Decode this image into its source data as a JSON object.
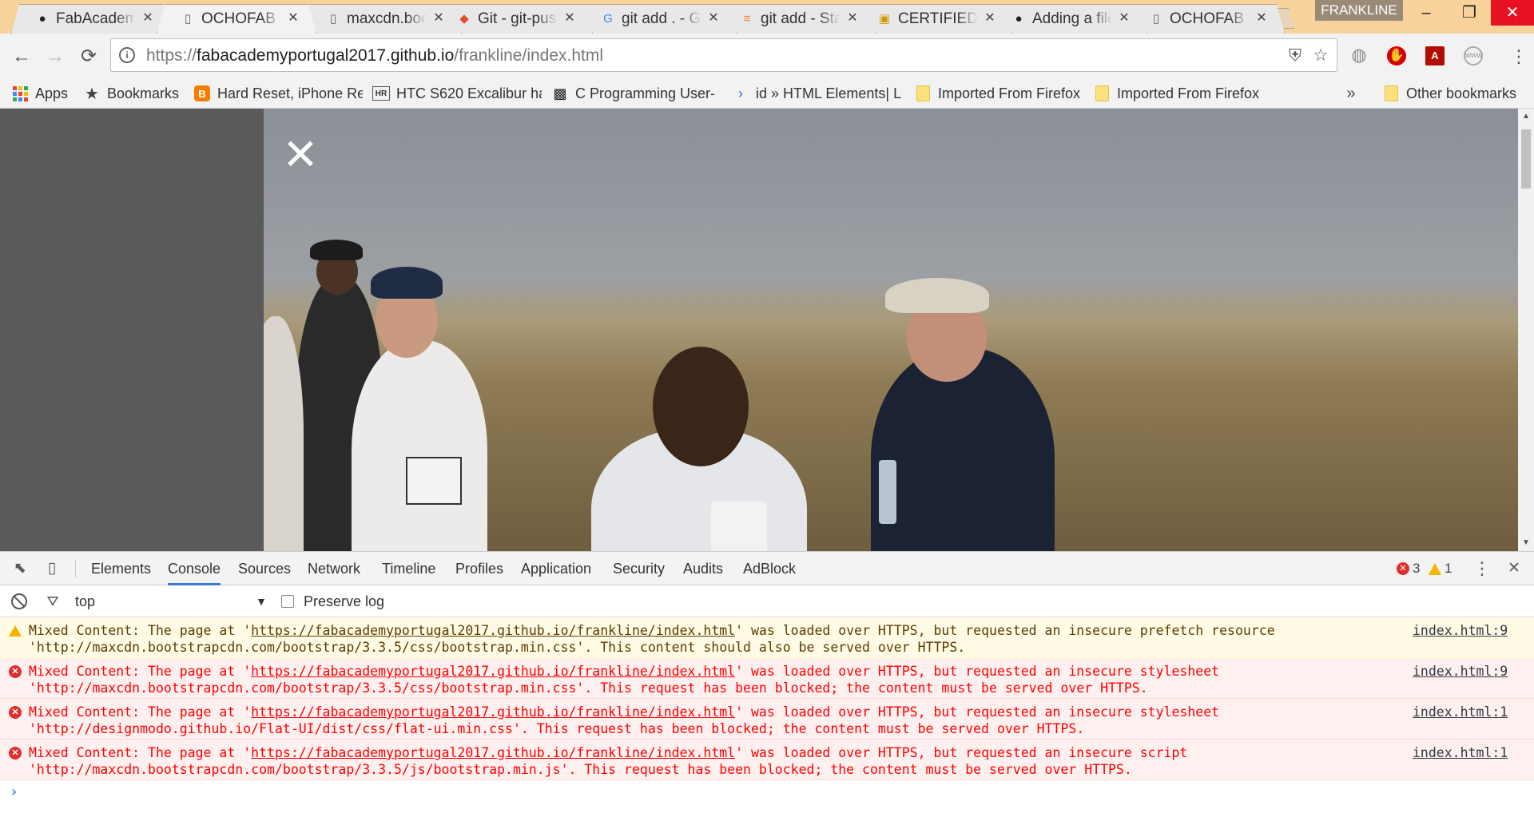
{
  "browser": {
    "tabs": [
      {
        "title": "FabAcademy",
        "icon": "github-icon",
        "active": false
      },
      {
        "title": "OCHOFAB",
        "icon": "page-icon",
        "active": true
      },
      {
        "title": "maxcdn.bootstrapcdn.com",
        "icon": "page-icon",
        "active": false
      },
      {
        "title": "Git - git-push",
        "icon": "git-icon",
        "active": false
      },
      {
        "title": "git add . - Google Search",
        "icon": "google-icon",
        "active": false
      },
      {
        "title": "git add - Stack Overflow",
        "icon": "stackoverflow-icon",
        "active": false
      },
      {
        "title": "CERTIFIED",
        "icon": "certified-icon",
        "active": false
      },
      {
        "title": "Adding a file",
        "icon": "github-icon",
        "active": false
      },
      {
        "title": "OCHOFAB",
        "icon": "page-icon",
        "active": false
      }
    ],
    "tab_close_glyph": "✕",
    "profile_name": "FRANKLINE",
    "window": {
      "minimize": "–",
      "maximize": "❐",
      "close": "✕"
    },
    "nav": {
      "back": "←",
      "forward": "→",
      "reload": "⟳"
    },
    "address": {
      "scheme": "https://",
      "host": "fabacademyportugal2017.github.io",
      "path": "/frankline/index.html",
      "info_glyph": "i"
    },
    "omnibox_icons": {
      "shield": "⛨",
      "star": "☆"
    },
    "extensions": [
      {
        "name": "extension-gray-icon",
        "glyph": "◍"
      },
      {
        "name": "adblock-icon",
        "glyph": "✋"
      },
      {
        "name": "acrobat-icon",
        "glyph": "A"
      },
      {
        "name": "extension-round-icon",
        "glyph": "www"
      }
    ],
    "menu_glyph": "⋮"
  },
  "bookmarks": {
    "items": [
      {
        "label": "Apps",
        "icon": "apps-grid-icon"
      },
      {
        "label": "Bookmarks",
        "icon": "star-icon"
      },
      {
        "label": "Hard Reset, iPhone Re",
        "icon": "blogger-icon"
      },
      {
        "label": "HTC S620 Excalibur ha",
        "icon": "hr-icon"
      },
      {
        "label": "C Programming User-",
        "icon": "ccpp-icon"
      },
      {
        "label": "id » HTML Elements| L",
        "icon": "arrow-icon"
      },
      {
        "label": "Imported From Firefox",
        "icon": "folder-icon"
      },
      {
        "label": "Imported From Firefox",
        "icon": "folder-icon"
      }
    ],
    "chevron": "»",
    "other": {
      "label": "Other bookmarks",
      "icon": "folder-icon"
    }
  },
  "page": {
    "close_glyph": "✕"
  },
  "scrollbar": {
    "up": "▲",
    "down": "▼"
  },
  "devtools": {
    "tabs": [
      "Elements",
      "Console",
      "Sources",
      "Network",
      "Timeline",
      "Profiles",
      "Application",
      "Security",
      "Audits",
      "AdBlock"
    ],
    "active_tab": "Console",
    "tool_icons": {
      "inspect": "⬉",
      "device": "▯"
    },
    "error_count": "3",
    "warning_count": "1",
    "more_glyph": "⋮",
    "close_glyph": "✕",
    "context": "top",
    "context_caret": "▼",
    "filter_glyph": "⛛",
    "preserve_log_label": "Preserve log",
    "prompt": "›",
    "messages": [
      {
        "level": "warning",
        "text_before": "Mixed Content: The page at '",
        "link": "https://fabacademyportugal2017.github.io/frankline/index.html",
        "text_after": "' was loaded over HTTPS, but requested an insecure prefetch resource",
        "line2": "'http://maxcdn.bootstrapcdn.com/bootstrap/3.3.5/css/bootstrap.min.css'. This content should also be served over HTTPS.",
        "source": "index.html:9"
      },
      {
        "level": "error",
        "text_before": "Mixed Content: The page at '",
        "link": "https://fabacademyportugal2017.github.io/frankline/index.html",
        "text_after": "' was loaded over HTTPS, but requested an insecure stylesheet",
        "line2": "'http://maxcdn.bootstrapcdn.com/bootstrap/3.3.5/css/bootstrap.min.css'. This request has been blocked; the content must be served over HTTPS.",
        "source": "index.html:9"
      },
      {
        "level": "error",
        "text_before": "Mixed Content: The page at '",
        "link": "https://fabacademyportugal2017.github.io/frankline/index.html",
        "text_after": "' was loaded over HTTPS, but requested an insecure stylesheet",
        "line2": "'http://designmodo.github.io/Flat-UI/dist/css/flat-ui.min.css'. This request has been blocked; the content must be served over HTTPS.",
        "source": "index.html:1"
      },
      {
        "level": "error",
        "text_before": "Mixed Content: The page at '",
        "link": "https://fabacademyportugal2017.github.io/frankline/index.html",
        "text_after": "' was loaded over HTTPS, but requested an insecure script",
        "line2": "'http://maxcdn.bootstrapcdn.com/bootstrap/3.3.5/js/bootstrap.min.js'. This request has been blocked; the content must be served over HTTPS.",
        "source": "index.html:1"
      }
    ],
    "error_glyph": "✕"
  }
}
